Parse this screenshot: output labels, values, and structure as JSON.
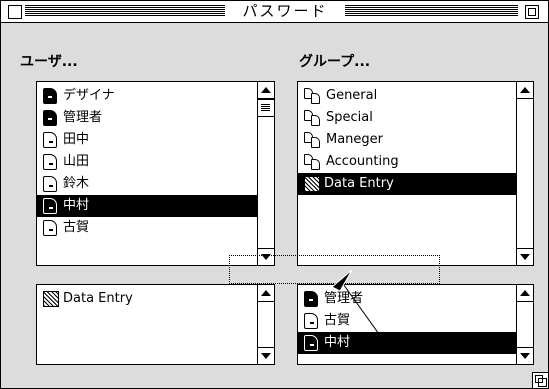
{
  "window": {
    "title": "パスワード"
  },
  "users_section": {
    "label": "ユーザ..."
  },
  "groups_section": {
    "label": "グループ..."
  },
  "users_list": [
    {
      "label": "デザイナ",
      "icon": "user-black",
      "selected": false
    },
    {
      "label": "管理者",
      "icon": "user-black",
      "selected": false
    },
    {
      "label": "田中",
      "icon": "user-white",
      "selected": false
    },
    {
      "label": "山田",
      "icon": "user-white",
      "selected": false
    },
    {
      "label": "鈴木",
      "icon": "user-white",
      "selected": false
    },
    {
      "label": "中村",
      "icon": "user-white",
      "selected": true
    },
    {
      "label": "古賀",
      "icon": "user-white",
      "selected": false
    }
  ],
  "groups_list": [
    {
      "label": "General",
      "icon": "group",
      "selected": false
    },
    {
      "label": "Special",
      "icon": "group",
      "selected": false
    },
    {
      "label": "Maneger",
      "icon": "group",
      "selected": false
    },
    {
      "label": "Accounting",
      "icon": "group",
      "selected": false
    },
    {
      "label": "Data Entry",
      "icon": "pattern",
      "selected": true
    }
  ],
  "user_groups_list": [
    {
      "label": "Data Entry",
      "icon": "pattern",
      "selected": false
    }
  ],
  "group_members_list": [
    {
      "label": "管理者",
      "icon": "user-black",
      "selected": false
    },
    {
      "label": "古賀",
      "icon": "user-white",
      "selected": false
    },
    {
      "label": "中村",
      "icon": "user-white",
      "selected": true
    }
  ]
}
